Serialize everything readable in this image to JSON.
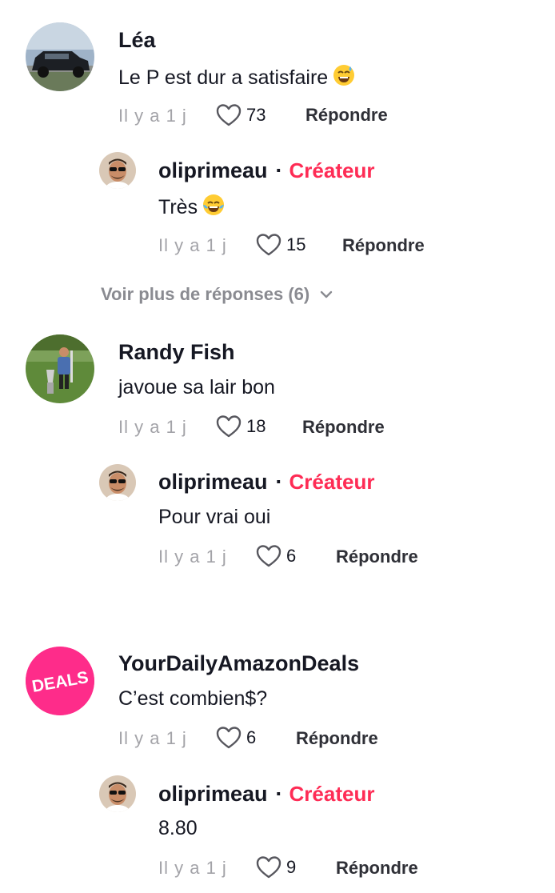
{
  "comments": [
    {
      "author": "Léa",
      "text": "Le P est dur a satisfaire",
      "emoji": "sweat-smile",
      "time": "Il y a 1 j",
      "likes": "73",
      "reply_label": "Répondre",
      "reply": {
        "author": "oliprimeau",
        "dot": "·",
        "badge": "Créateur",
        "text": "Très",
        "emoji": "tears-of-joy",
        "time": "Il y a 1 j",
        "likes": "15",
        "reply_label": "Répondre"
      },
      "more_replies": "Voir plus de réponses (6)"
    },
    {
      "author": "Randy Fish",
      "text": "javoue sa lair bon",
      "time": "Il y a 1 j",
      "likes": "18",
      "reply_label": "Répondre",
      "reply": {
        "author": "oliprimeau",
        "dot": "·",
        "badge": "Créateur",
        "text": "Pour vrai oui",
        "time": "Il y a 1 j",
        "likes": "6",
        "reply_label": "Répondre"
      }
    },
    {
      "author": "YourDailyAmazonDeals",
      "avatar_text": "DEALS",
      "text": "C’est combien$?",
      "time": "Il y a 1 j",
      "likes": "6",
      "reply_label": "Répondre",
      "reply": {
        "author": "oliprimeau",
        "dot": "·",
        "badge": "Créateur",
        "text": "8.80",
        "time": "Il y a 1 j",
        "likes": "9",
        "reply_label": "Répondre"
      }
    }
  ],
  "colors": {
    "creator_badge": "#fe2c55",
    "deals_avatar": "#fe2c8a",
    "meta_gray": "#a3a3a8"
  }
}
